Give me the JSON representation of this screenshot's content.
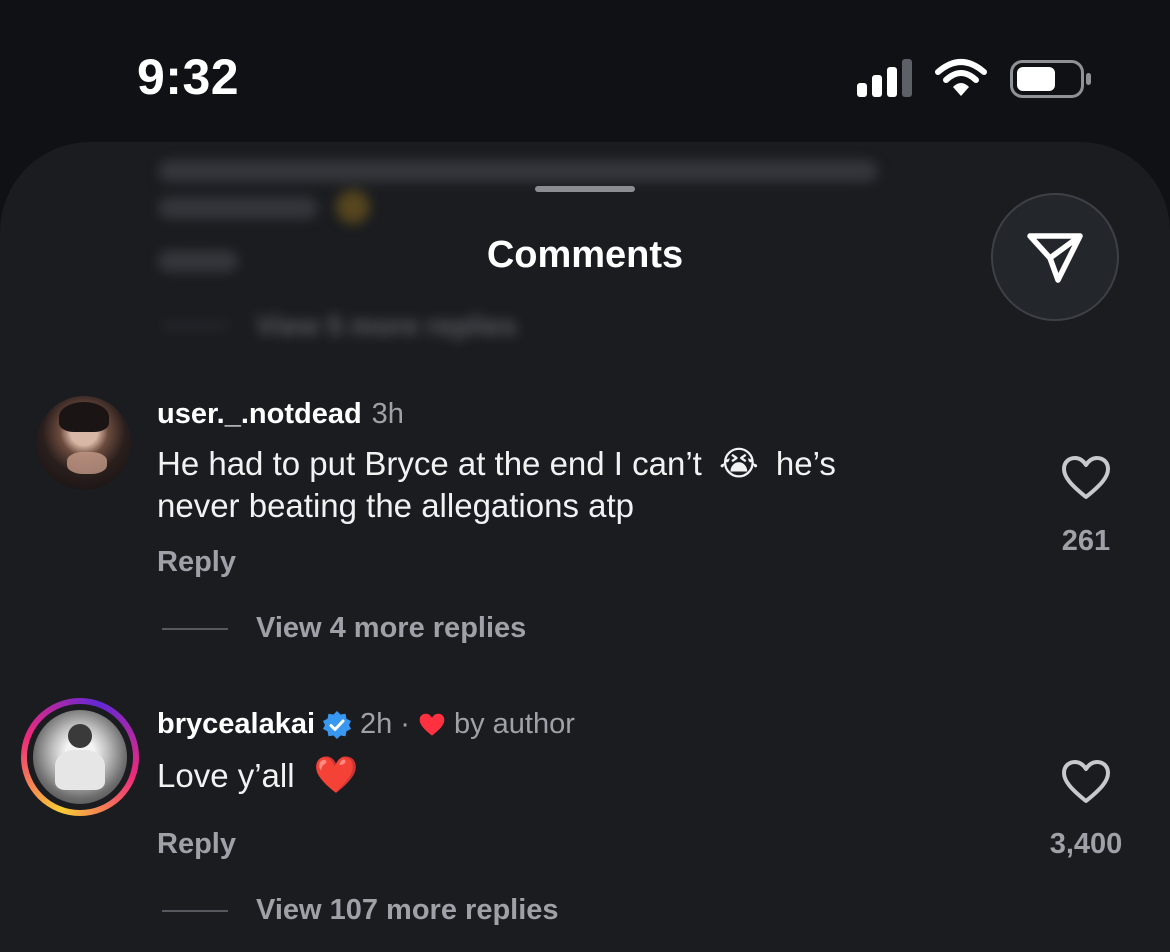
{
  "status_bar": {
    "time": "9:32",
    "signal_icon": "cellular-signal-icon",
    "wifi_icon": "wifi-icon",
    "battery_icon": "battery-icon"
  },
  "sheet": {
    "title": "Comments",
    "share_icon": "send-icon",
    "handle_icon": "drag-handle"
  },
  "previous_thread": {
    "view_more_label": "View 5 more replies"
  },
  "comments": [
    {
      "username": "user._.notdead",
      "time": "3h",
      "text_line1_a": "He had to put Bryce at the end I can’t",
      "text_line1_emoji": "😭",
      "text_line1_b": "he’s",
      "text_line2": "never beating the allegations atp",
      "reply_label": "Reply",
      "like_count": "261",
      "view_more_label": "View 4 more replies"
    },
    {
      "username": "brycealakai",
      "verified": true,
      "time": "2h",
      "separator": "·",
      "liked_by_author_label": "by author",
      "text": "Love y’all",
      "text_emoji": "❤️",
      "reply_label": "Reply",
      "like_count": "3,400",
      "view_more_label": "View 107 more replies"
    }
  ],
  "colors": {
    "background": "#0f1114",
    "sheet": "#1a1c20",
    "secondary_text": "#9ea1a7",
    "verified_blue": "#3897f0",
    "heart_red": "#ff3040",
    "story_ring_start": "#f9ce34",
    "story_ring_mid": "#ee2a7b",
    "story_ring_end": "#6228d7"
  }
}
